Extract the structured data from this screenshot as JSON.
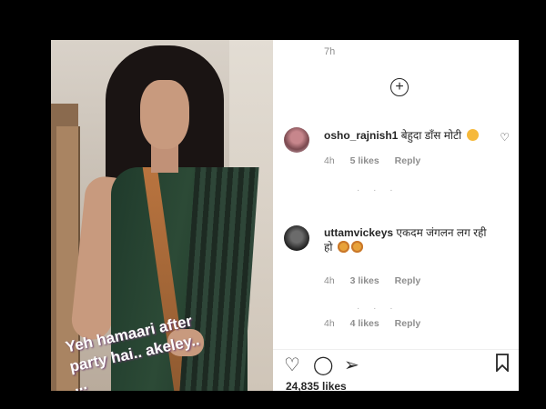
{
  "video": {
    "caption_line1": "Yeh hamaari after",
    "caption_line2": "party hai.. akeley..",
    "caption_line3": "..."
  },
  "comments_panel": {
    "top_timestamp": "7h",
    "load_more_icon": "plus-circle-icon",
    "comments": [
      {
        "username": "osho_rajnish1",
        "text": "बेहुदा डाँस मोटी",
        "emojis": [
          "laughing-tears"
        ],
        "time": "4h",
        "likes": "5 likes",
        "reply_label": "Reply"
      },
      {
        "username": "uttamvickeys",
        "text": "एकदम जंगलन लग रही हो",
        "emojis": [
          "angry",
          "angry"
        ],
        "time": "4h",
        "likes": "3 likes",
        "reply_label": "Reply"
      },
      {
        "time": "4h",
        "likes": "4 likes",
        "reply_label": "Reply"
      }
    ],
    "likes_count": "24,835 likes"
  },
  "icons": {
    "like": "heart-icon",
    "comment": "comment-icon",
    "share": "send-icon",
    "save": "bookmark-icon"
  },
  "colors": {
    "text": "#262626",
    "muted": "#8e8e8e",
    "background": "#ffffff"
  }
}
